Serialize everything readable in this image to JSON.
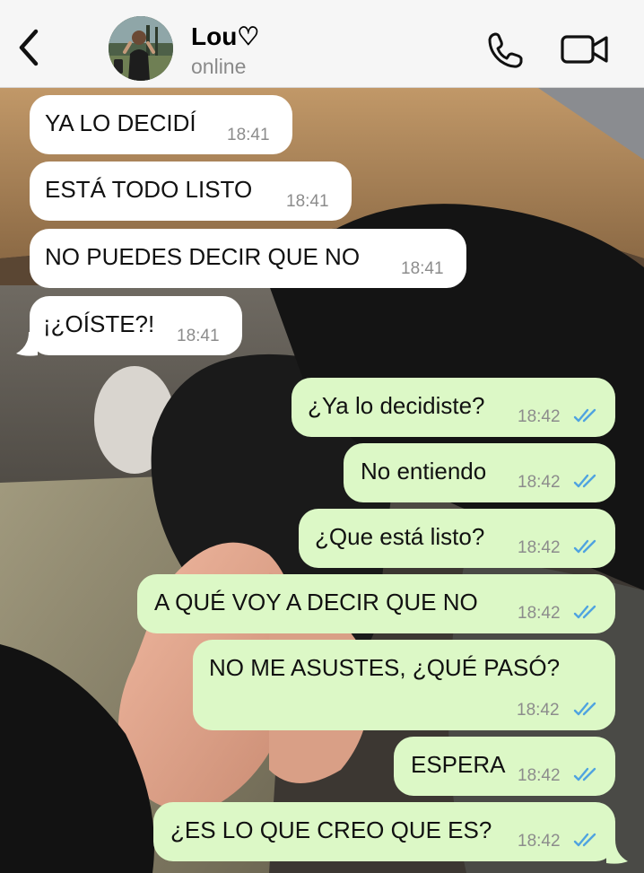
{
  "header": {
    "contact_name": "Lou♡",
    "status": "online"
  },
  "icons": {
    "back": "chevron-left-icon",
    "call": "phone-icon",
    "video": "video-camera-icon",
    "read": "double-check-icon"
  },
  "colors": {
    "incoming_bubble": "#ffffff",
    "outgoing_bubble": "#dcf8c6",
    "read_ticks": "#4fa3e0",
    "timestamp": "#8c8c8c"
  },
  "messages": [
    {
      "direction": "in",
      "text": "YA LO DECIDÍ",
      "time": "18:41"
    },
    {
      "direction": "in",
      "text": "ESTÁ TODO LISTO",
      "time": "18:41"
    },
    {
      "direction": "in",
      "text": "NO PUEDES DECIR QUE NO",
      "time": "18:41"
    },
    {
      "direction": "in",
      "text": "¡¿OÍSTE?!",
      "time": "18:41"
    },
    {
      "direction": "out",
      "text": "¿Ya lo decidiste?",
      "time": "18:42",
      "read": true
    },
    {
      "direction": "out",
      "text": "No entiendo",
      "time": "18:42",
      "read": true
    },
    {
      "direction": "out",
      "text": "¿Que está listo?",
      "time": "18:42",
      "read": true
    },
    {
      "direction": "out",
      "text": "A QUÉ VOY A DECIR QUE NO",
      "time": "18:42",
      "read": true
    },
    {
      "direction": "out",
      "text": "NO ME ASUSTES, ¿QUÉ PASÓ?",
      "time": "18:42",
      "read": true
    },
    {
      "direction": "out",
      "text": "ESPERA",
      "time": "18:42",
      "read": true
    },
    {
      "direction": "out",
      "text": "¿ES LO QUE CREO QUE ES?",
      "time": "18:42",
      "read": true
    }
  ]
}
